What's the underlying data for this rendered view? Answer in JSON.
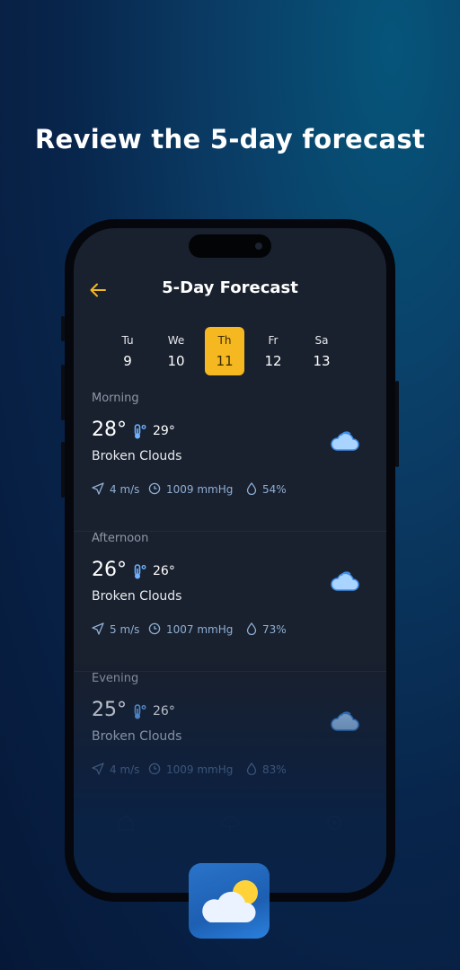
{
  "headline": "Review the 5-day forecast",
  "header": {
    "title": "5-Day Forecast"
  },
  "days": [
    {
      "name": "Tu",
      "date": "9"
    },
    {
      "name": "We",
      "date": "10"
    },
    {
      "name": "Th",
      "date": "11",
      "selected": true
    },
    {
      "name": "Fr",
      "date": "12"
    },
    {
      "name": "Sa",
      "date": "13"
    }
  ],
  "periods": [
    {
      "label": "Morning",
      "temp": "28°",
      "feels": "29°",
      "condition": "Broken Clouds",
      "wind": "4 m/s",
      "pressure": "1009 mmHg",
      "humidity": "54%"
    },
    {
      "label": "Afternoon",
      "temp": "26°",
      "feels": "26°",
      "condition": "Broken Clouds",
      "wind": "5 m/s",
      "pressure": "1007 mmHg",
      "humidity": "73%"
    },
    {
      "label": "Evening",
      "temp": "25°",
      "feels": "26°",
      "condition": "Broken Clouds",
      "wind": "4 m/s",
      "pressure": "1009 mmHg",
      "humidity": "83%"
    }
  ],
  "colors": {
    "accent": "#f5b821",
    "screen_bg": "#19202e",
    "stat_text": "#8fb0d4"
  },
  "icons": {
    "back": "arrow-left-icon",
    "feels": "thermometer-icon",
    "condition": "cloud-icon",
    "wind": "navigation-arrow-icon",
    "pressure": "clock-icon",
    "humidity": "droplet-icon",
    "app": "sun-cloud-icon"
  }
}
